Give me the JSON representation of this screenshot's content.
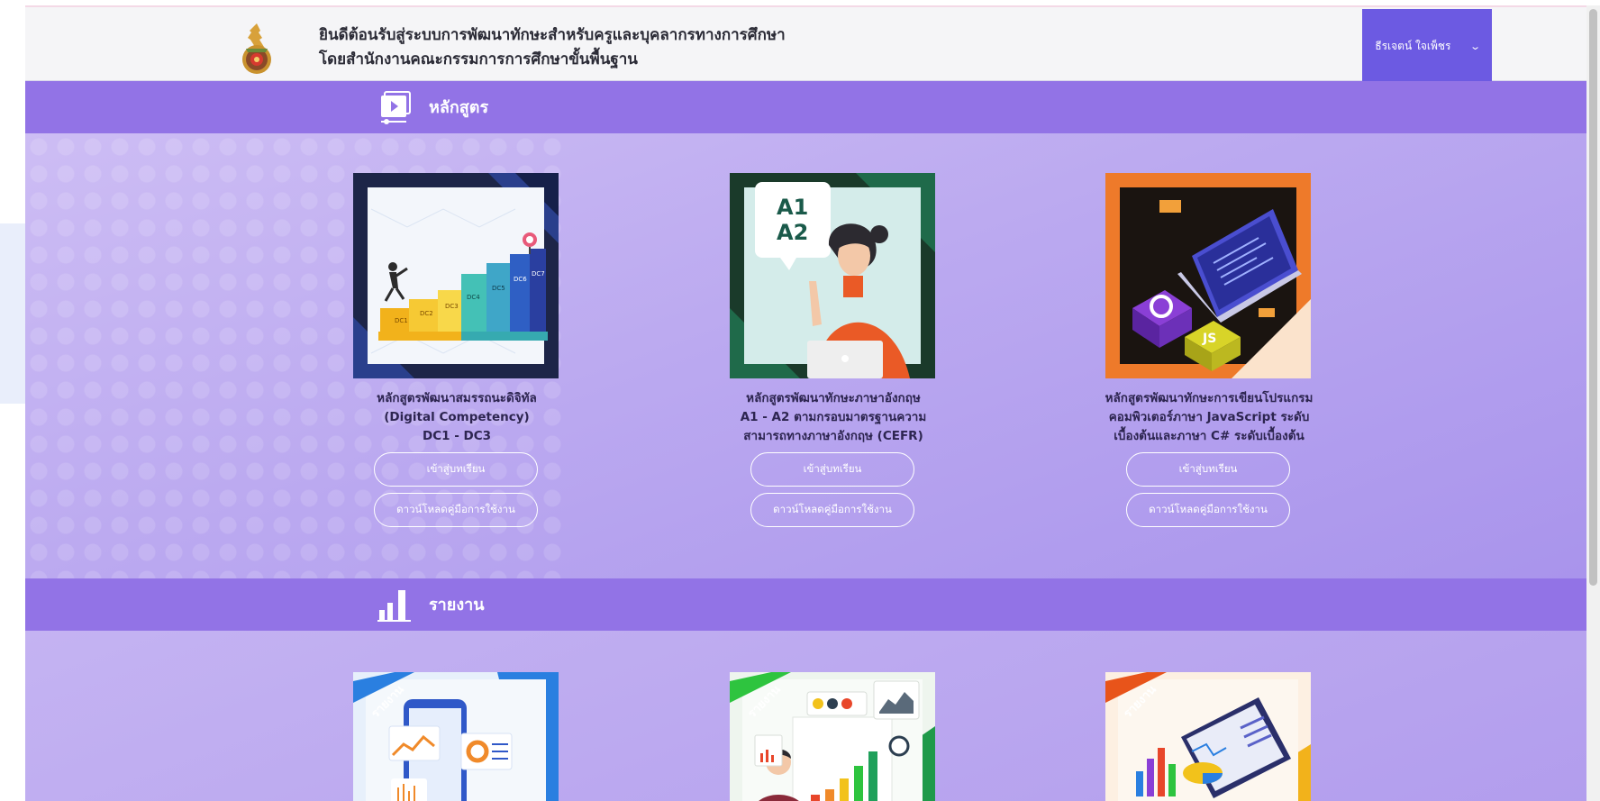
{
  "header": {
    "title_line1": "ยินดีต้อนรับสู่ระบบการพัฒนาทักษะสำหรับครูและบุคลากรทางการศึกษา",
    "title_line2": "โดยสำนักงานคณะกรรมการการศึกษาขั้นพื้นฐาน",
    "user_name": "ธีรเจตน์ ใจเพ็ชร",
    "logo_icon": "ministry-seal-icon"
  },
  "sections": {
    "courses": {
      "label": "หลักสูตร",
      "icon": "video-player-icon"
    },
    "reports": {
      "label": "รายงาน",
      "icon": "bar-chart-icon"
    }
  },
  "courses": [
    {
      "title_lines": [
        "หลักสูตรพัฒนาสมรรถนะดิจิทัล",
        "(Digital Competency)",
        "DC1 - DC3"
      ],
      "enter_label": "เข้าสู่บทเรียน",
      "manual_label": "ดาวน์โหลดคู่มือการใช้งาน",
      "thumb_texts": [
        "DC1",
        "DC2",
        "DC3",
        "DC4",
        "DC5",
        "DC6",
        "DC7"
      ]
    },
    {
      "title_lines": [
        "หลักสูตรพัฒนาทักษะภาษาอังกฤษ",
        "A1 - A2 ตามกรอบมาตรฐานความ",
        "สามารถทางภาษาอังกฤษ (CEFR)"
      ],
      "enter_label": "เข้าสู่บทเรียน",
      "manual_label": "ดาวน์โหลดคู่มือการใช้งาน",
      "thumb_texts": [
        "A1",
        "A2"
      ]
    },
    {
      "title_lines": [
        "หลักสูตรพัฒนาทักษะการเขียนโปรแกรม",
        "คอมพิวเตอร์ภาษา JavaScript ระดับ",
        "เบื้องต้นและภาษา C# ระดับเบื้องต้น"
      ],
      "enter_label": "เข้าสู่บทเรียน",
      "manual_label": "ดาวน์โหลดคู่มือการใช้งาน",
      "thumb_texts": [
        "JS"
      ]
    }
  ],
  "reports": [
    {
      "ribbon": "รายงาน",
      "ribbon_color": "#2a7fe0"
    },
    {
      "ribbon": "รายงาน",
      "ribbon_color": "#2ec43f"
    },
    {
      "ribbon": "รายงาน",
      "ribbon_color": "#e8541a"
    }
  ],
  "colors": {
    "section_bar": "#9273e6",
    "user_button": "#6c5ae2",
    "background": "#b8a7ee"
  }
}
